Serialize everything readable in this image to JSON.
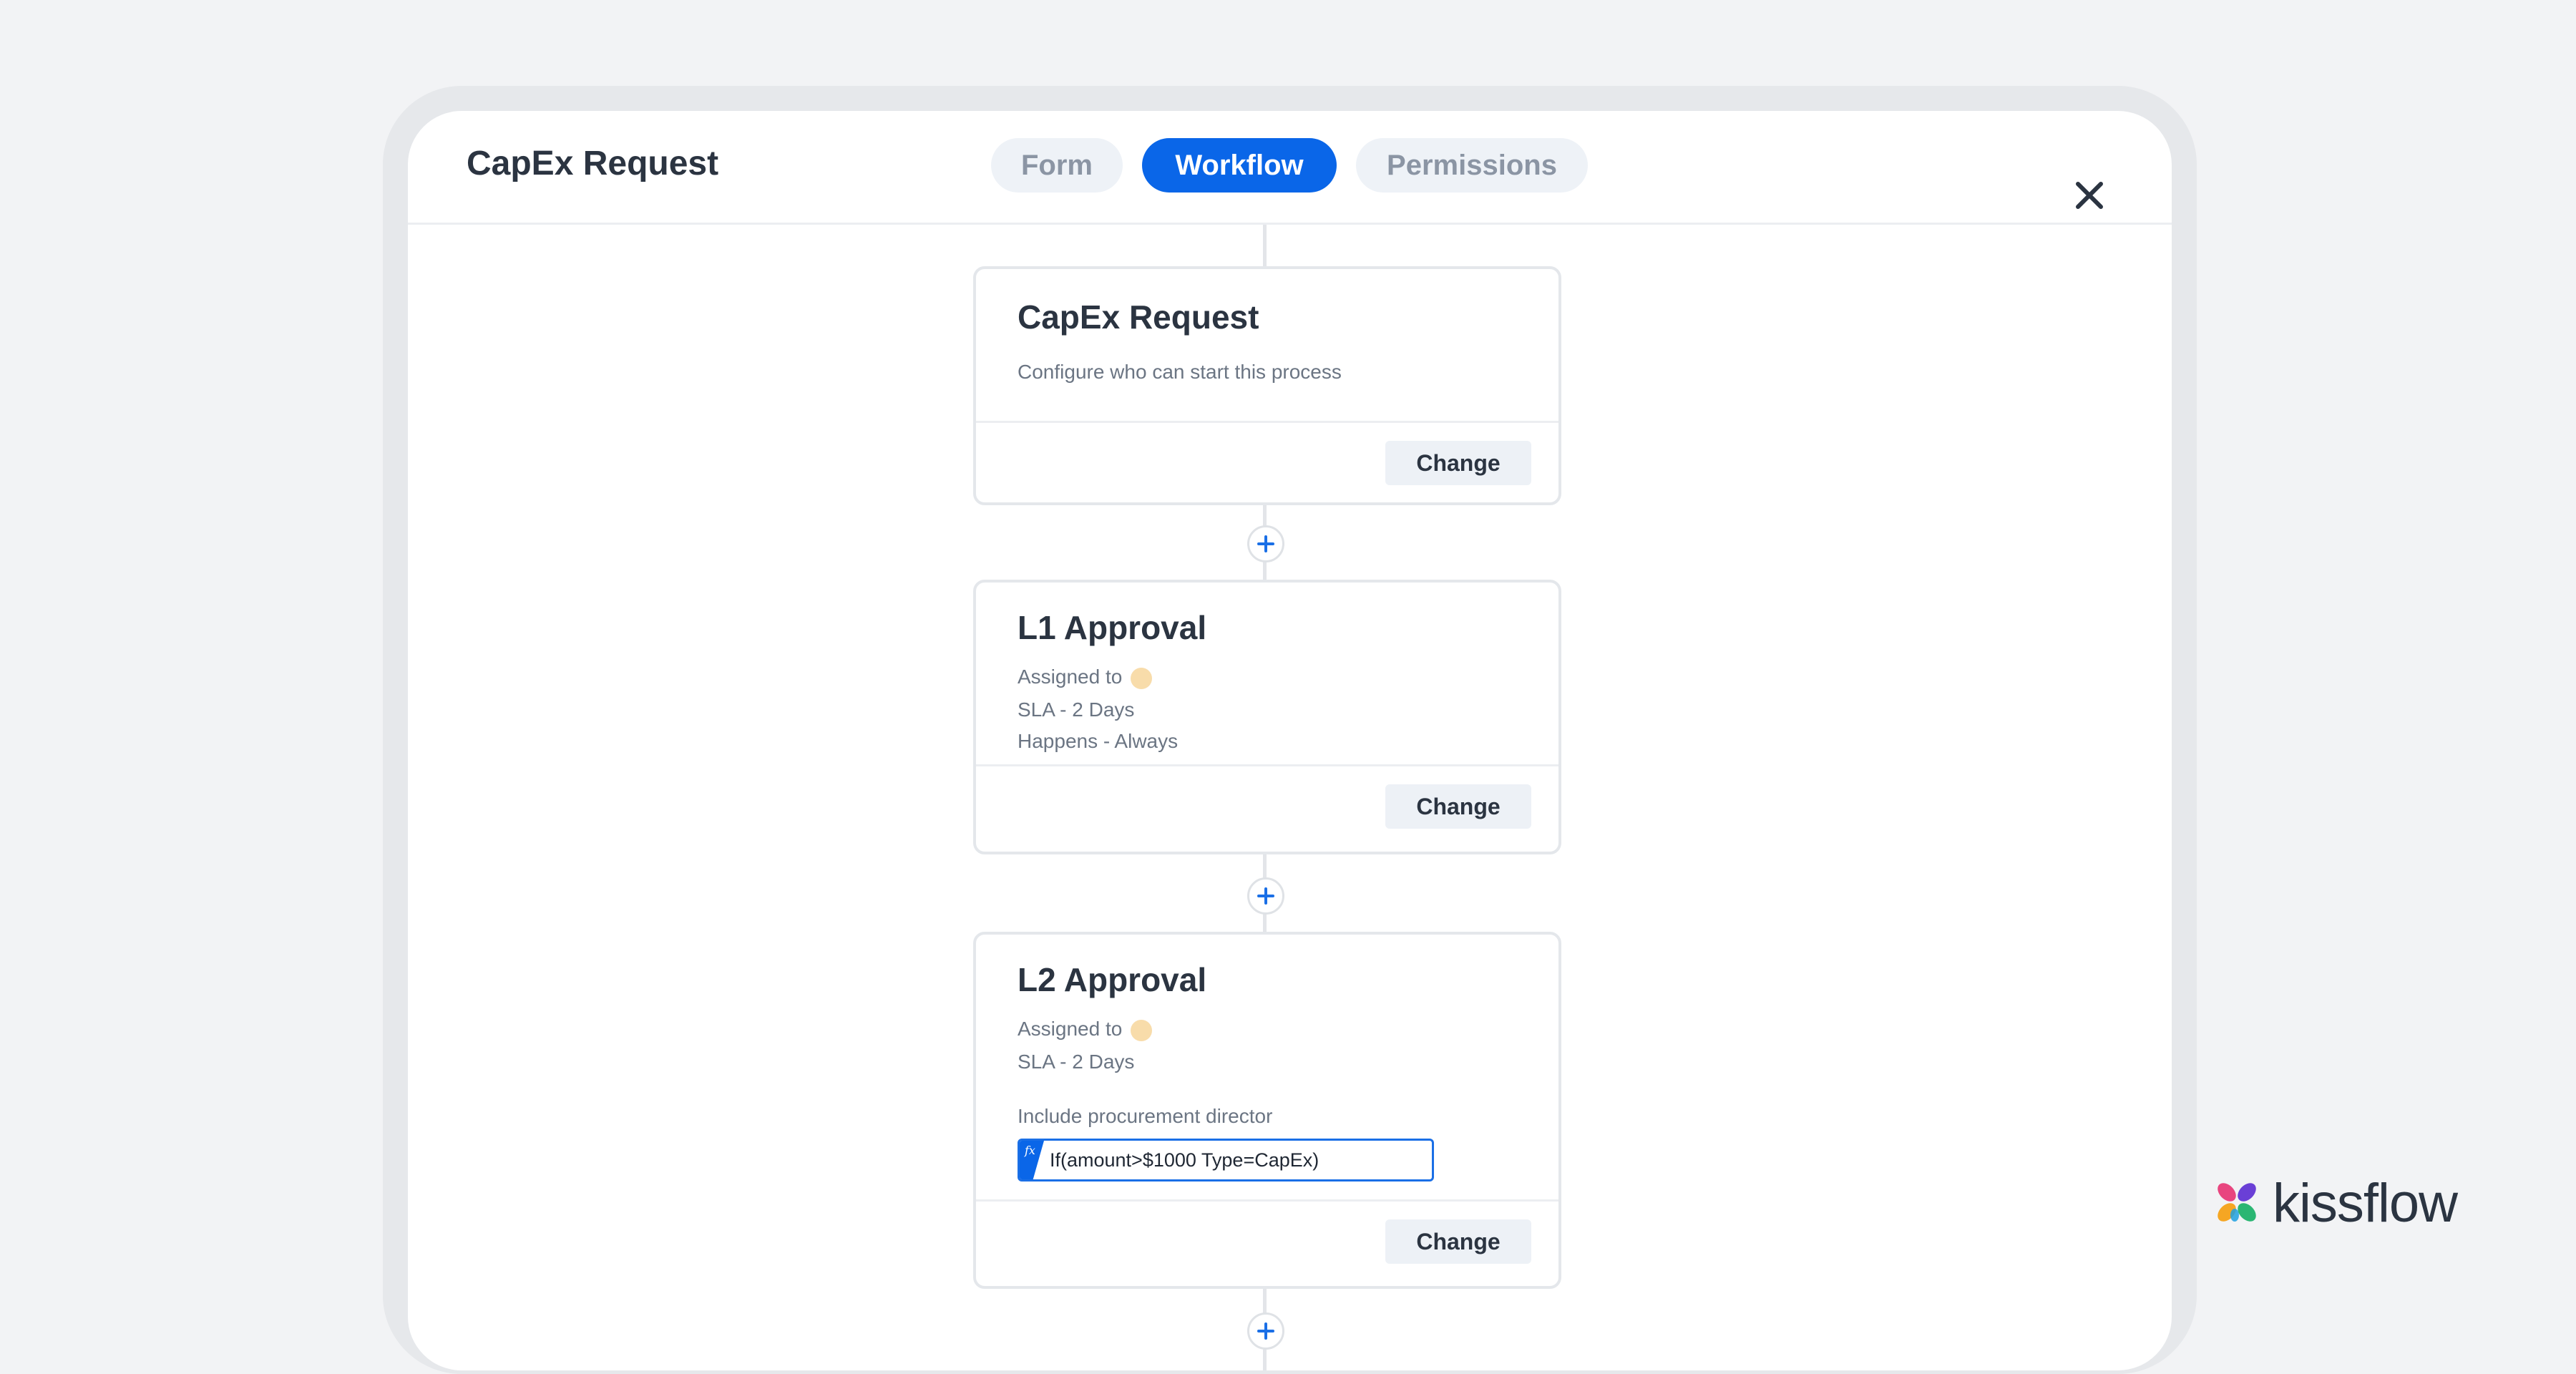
{
  "app": {
    "title": "CapEx Request"
  },
  "tabs": [
    {
      "label": "Form",
      "active": false
    },
    {
      "label": "Workflow",
      "active": true
    },
    {
      "label": "Permissions",
      "active": false
    }
  ],
  "workflow": {
    "start_step": {
      "title": "CapEx Request",
      "description": "Configure who can start this process",
      "action_label": "Change"
    },
    "steps": [
      {
        "title": "L1 Approval",
        "assigned_label": "Assigned to",
        "sla": "SLA - 2 Days",
        "happens": "Happens - Always",
        "action_label": "Change"
      },
      {
        "title": "L2 Approval",
        "assigned_label": "Assigned to",
        "sla": "SLA - 2 Days",
        "condition_label": "Include procurement director",
        "fx_label": "fx",
        "condition_expression": "If(amount>$1000 Type=CapEx)",
        "action_label": "Change"
      }
    ]
  },
  "brand": {
    "name": "kissflow"
  },
  "colors": {
    "accent": "#0a66e8",
    "tab_inactive_bg": "#eef2f7",
    "avatar": "#f8dcaa",
    "background": "#f2f3f5"
  },
  "icons": {
    "close": "close-icon",
    "add": "plus-icon",
    "formula": "fx-icon",
    "logo": "kissflow-logo-icon"
  }
}
